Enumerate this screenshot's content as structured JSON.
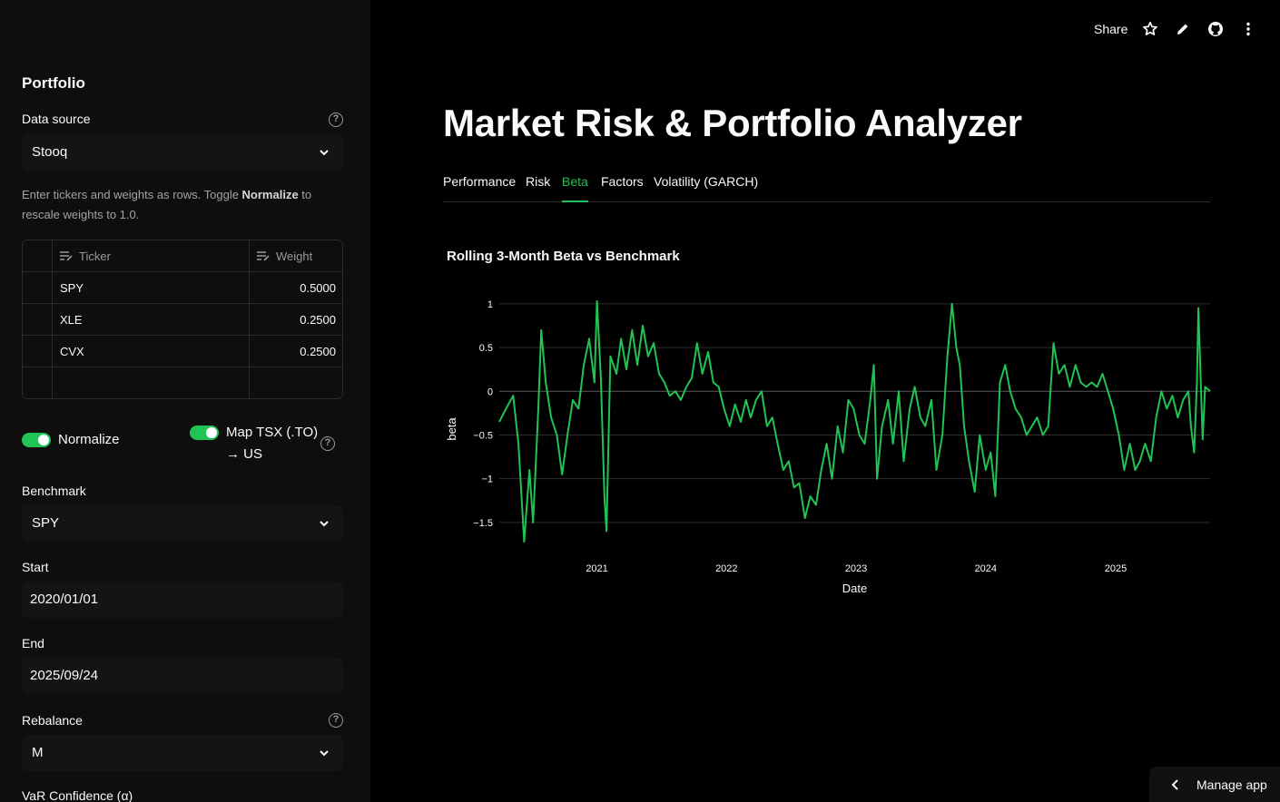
{
  "header": {
    "share_label": "Share",
    "icons": [
      "star-icon",
      "pencil-icon",
      "github-icon",
      "more-vertical-icon"
    ]
  },
  "sidebar": {
    "heading": "Portfolio",
    "data_source": {
      "label": "Data source",
      "value": "Stooq"
    },
    "caption_pre": "Enter tickers and weights as rows. Toggle ",
    "caption_bold": "Normalize",
    "caption_post": " to rescale weights to 1.0.",
    "table": {
      "columns": [
        "Ticker",
        "Weight"
      ],
      "rows": [
        {
          "ticker": "SPY",
          "weight": "0.5000"
        },
        {
          "ticker": "XLE",
          "weight": "0.2500"
        },
        {
          "ticker": "CVX",
          "weight": "0.2500"
        }
      ]
    },
    "normalize": {
      "label": "Normalize",
      "on": true
    },
    "map_tsx": {
      "label_line1": "Map TSX (.TO)",
      "label_line2": "→ US",
      "on": true
    },
    "benchmark": {
      "label": "Benchmark",
      "value": "SPY"
    },
    "start": {
      "label": "Start",
      "value": "2020/01/01"
    },
    "end": {
      "label": "End",
      "value": "2025/09/24"
    },
    "rebalance": {
      "label": "Rebalance",
      "value": "M"
    },
    "var_confidence": {
      "label": "VaR Confidence (α)"
    }
  },
  "main": {
    "title": "Market Risk & Portfolio Analyzer",
    "tabs": [
      {
        "label": "Performance",
        "active": false
      },
      {
        "label": "Risk",
        "active": false
      },
      {
        "label": "Beta",
        "active": true
      },
      {
        "label": "Factors",
        "active": false
      },
      {
        "label": "Volatility (GARCH)",
        "active": false
      }
    ]
  },
  "manage_app": {
    "label": "Manage app"
  },
  "colors": {
    "accent": "#21c354",
    "background": "#000000",
    "sidebar": "#0e0e0e"
  },
  "chart_data": {
    "type": "line",
    "title": "Rolling 3-Month Beta vs Benchmark",
    "xlabel": "Date",
    "ylabel": "beta",
    "x_range": [
      "2020-04-01",
      "2025-09-24"
    ],
    "ylim": [
      -1.75,
      1.05
    ],
    "yticks": [
      1,
      0.5,
      0,
      -0.5,
      -1,
      -1.5
    ],
    "ytick_labels": [
      "1",
      "0.5",
      "0",
      "−0.5",
      "−1",
      "−1.5"
    ],
    "xticks": [
      "2021-01-01",
      "2022-01-01",
      "2023-01-01",
      "2024-01-01",
      "2025-01-01"
    ],
    "xtick_labels": [
      "2021",
      "2022",
      "2023",
      "2024",
      "2025"
    ],
    "grid": true,
    "series": [
      {
        "color": "#21c354",
        "points": [
          [
            "2020-04-01",
            -0.35
          ],
          [
            "2020-04-20",
            -0.2
          ],
          [
            "2020-05-10",
            -0.05
          ],
          [
            "2020-05-25",
            -0.6
          ],
          [
            "2020-06-10",
            -1.72
          ],
          [
            "2020-06-25",
            -0.9
          ],
          [
            "2020-07-05",
            -1.5
          ],
          [
            "2020-07-20",
            -0.2
          ],
          [
            "2020-07-28",
            0.7
          ],
          [
            "2020-08-10",
            0.1
          ],
          [
            "2020-08-25",
            -0.3
          ],
          [
            "2020-09-10",
            -0.5
          ],
          [
            "2020-09-25",
            -0.95
          ],
          [
            "2020-10-10",
            -0.5
          ],
          [
            "2020-10-25",
            -0.1
          ],
          [
            "2020-11-10",
            -0.2
          ],
          [
            "2020-11-25",
            0.3
          ],
          [
            "2020-12-10",
            0.6
          ],
          [
            "2020-12-25",
            0.1
          ],
          [
            "2021-01-01",
            1.03
          ],
          [
            "2021-01-12",
            0.15
          ],
          [
            "2021-01-22",
            -1.2
          ],
          [
            "2021-01-28",
            -1.6
          ],
          [
            "2021-02-08",
            0.4
          ],
          [
            "2021-02-25",
            0.2
          ],
          [
            "2021-03-10",
            0.6
          ],
          [
            "2021-03-25",
            0.25
          ],
          [
            "2021-04-10",
            0.7
          ],
          [
            "2021-04-25",
            0.3
          ],
          [
            "2021-05-10",
            0.75
          ],
          [
            "2021-05-25",
            0.4
          ],
          [
            "2021-06-10",
            0.55
          ],
          [
            "2021-06-25",
            0.2
          ],
          [
            "2021-07-10",
            0.1
          ],
          [
            "2021-07-25",
            -0.05
          ],
          [
            "2021-08-10",
            0.0
          ],
          [
            "2021-08-25",
            -0.1
          ],
          [
            "2021-09-10",
            0.05
          ],
          [
            "2021-09-25",
            0.15
          ],
          [
            "2021-10-10",
            0.55
          ],
          [
            "2021-10-25",
            0.2
          ],
          [
            "2021-11-10",
            0.45
          ],
          [
            "2021-11-25",
            0.1
          ],
          [
            "2021-12-10",
            0.05
          ],
          [
            "2021-12-25",
            -0.2
          ],
          [
            "2022-01-10",
            -0.4
          ],
          [
            "2022-01-25",
            -0.15
          ],
          [
            "2022-02-10",
            -0.35
          ],
          [
            "2022-02-25",
            -0.1
          ],
          [
            "2022-03-10",
            -0.3
          ],
          [
            "2022-03-25",
            -0.1
          ],
          [
            "2022-04-10",
            0.0
          ],
          [
            "2022-04-25",
            -0.4
          ],
          [
            "2022-05-10",
            -0.3
          ],
          [
            "2022-05-25",
            -0.6
          ],
          [
            "2022-06-10",
            -0.9
          ],
          [
            "2022-06-25",
            -0.8
          ],
          [
            "2022-07-10",
            -1.1
          ],
          [
            "2022-07-25",
            -1.05
          ],
          [
            "2022-08-10",
            -1.45
          ],
          [
            "2022-08-25",
            -1.2
          ],
          [
            "2022-09-10",
            -1.3
          ],
          [
            "2022-09-25",
            -0.9
          ],
          [
            "2022-10-10",
            -0.6
          ],
          [
            "2022-10-25",
            -1.0
          ],
          [
            "2022-11-10",
            -0.4
          ],
          [
            "2022-11-25",
            -0.7
          ],
          [
            "2022-12-10",
            -0.1
          ],
          [
            "2022-12-25",
            -0.2
          ],
          [
            "2023-01-10",
            -0.5
          ],
          [
            "2023-01-25",
            -0.6
          ],
          [
            "2023-02-10",
            -0.1
          ],
          [
            "2023-02-20",
            0.3
          ],
          [
            "2023-03-01",
            -1.0
          ],
          [
            "2023-03-15",
            -0.4
          ],
          [
            "2023-04-01",
            -0.1
          ],
          [
            "2023-04-15",
            -0.6
          ],
          [
            "2023-05-01",
            0.0
          ],
          [
            "2023-05-15",
            -0.8
          ],
          [
            "2023-06-01",
            -0.2
          ],
          [
            "2023-06-15",
            0.05
          ],
          [
            "2023-07-01",
            -0.3
          ],
          [
            "2023-07-15",
            -0.4
          ],
          [
            "2023-08-01",
            -0.1
          ],
          [
            "2023-08-15",
            -0.9
          ],
          [
            "2023-09-01",
            -0.5
          ],
          [
            "2023-09-15",
            0.4
          ],
          [
            "2023-09-28",
            1.0
          ],
          [
            "2023-10-10",
            0.5
          ],
          [
            "2023-10-20",
            0.3
          ],
          [
            "2023-11-01",
            -0.4
          ],
          [
            "2023-11-15",
            -0.8
          ],
          [
            "2023-12-01",
            -1.15
          ],
          [
            "2023-12-15",
            -0.5
          ],
          [
            "2024-01-01",
            -0.9
          ],
          [
            "2024-01-15",
            -0.7
          ],
          [
            "2024-01-28",
            -1.2
          ],
          [
            "2024-02-10",
            0.1
          ],
          [
            "2024-02-25",
            0.3
          ],
          [
            "2024-03-10",
            0.0
          ],
          [
            "2024-03-25",
            -0.2
          ],
          [
            "2024-04-10",
            -0.3
          ],
          [
            "2024-04-25",
            -0.5
          ],
          [
            "2024-05-10",
            -0.4
          ],
          [
            "2024-05-25",
            -0.3
          ],
          [
            "2024-06-10",
            -0.5
          ],
          [
            "2024-06-25",
            -0.4
          ],
          [
            "2024-07-10",
            0.55
          ],
          [
            "2024-07-25",
            0.2
          ],
          [
            "2024-08-10",
            0.3
          ],
          [
            "2024-08-25",
            0.05
          ],
          [
            "2024-09-10",
            0.3
          ],
          [
            "2024-09-25",
            0.1
          ],
          [
            "2024-10-10",
            0.05
          ],
          [
            "2024-10-25",
            0.1
          ],
          [
            "2024-11-10",
            0.05
          ],
          [
            "2024-11-25",
            0.2
          ],
          [
            "2024-12-10",
            0.0
          ],
          [
            "2024-12-25",
            -0.2
          ],
          [
            "2025-01-10",
            -0.5
          ],
          [
            "2025-01-25",
            -0.9
          ],
          [
            "2025-02-10",
            -0.6
          ],
          [
            "2025-02-25",
            -0.9
          ],
          [
            "2025-03-10",
            -0.8
          ],
          [
            "2025-03-25",
            -0.6
          ],
          [
            "2025-04-10",
            -0.8
          ],
          [
            "2025-04-25",
            -0.3
          ],
          [
            "2025-05-10",
            0.0
          ],
          [
            "2025-05-25",
            -0.2
          ],
          [
            "2025-06-10",
            -0.05
          ],
          [
            "2025-06-25",
            -0.3
          ],
          [
            "2025-07-10",
            -0.1
          ],
          [
            "2025-07-25",
            0.0
          ],
          [
            "2025-08-01",
            -0.4
          ],
          [
            "2025-08-10",
            -0.7
          ],
          [
            "2025-08-18",
            0.1
          ],
          [
            "2025-08-22",
            0.95
          ],
          [
            "2025-08-28",
            0.2
          ],
          [
            "2025-09-03",
            -0.55
          ],
          [
            "2025-09-10",
            0.05
          ],
          [
            "2025-09-24",
            0.0
          ]
        ]
      }
    ]
  }
}
